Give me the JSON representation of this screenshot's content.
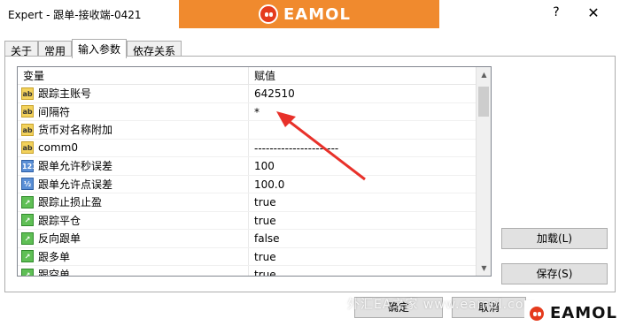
{
  "window": {
    "title": "Expert - 跟单-接收端-0421",
    "help_label": "?",
    "close_label": "✕"
  },
  "brand": {
    "name": "EAMOL",
    "color": "#f08a2e",
    "mark_color": "#e53b1d"
  },
  "tabs": [
    {
      "label": "关于"
    },
    {
      "label": "常用"
    },
    {
      "label": "输入参数"
    },
    {
      "label": "依存关系"
    }
  ],
  "grid": {
    "header_name": "变量",
    "header_value": "赋值",
    "rows": [
      {
        "icon": "ab",
        "name": "跟踪主账号",
        "value": "642510"
      },
      {
        "icon": "ab",
        "name": "间隔符",
        "value": "*"
      },
      {
        "icon": "ab",
        "name": "货币对名称附加",
        "value": ""
      },
      {
        "icon": "ab",
        "name": "comm0",
        "value": "----------------------"
      },
      {
        "icon": "123",
        "name": "跟单允许秒误差",
        "value": "100"
      },
      {
        "icon": "1/2",
        "name": "跟单允许点误差",
        "value": "100.0"
      },
      {
        "icon": "bool",
        "name": "跟踪止损止盈",
        "value": "true"
      },
      {
        "icon": "bool",
        "name": "跟踪平仓",
        "value": "true"
      },
      {
        "icon": "bool",
        "name": "反向跟单",
        "value": "false"
      },
      {
        "icon": "bool",
        "name": "跟多单",
        "value": "true"
      },
      {
        "icon": "bool",
        "name": "跟空单",
        "value": "true"
      }
    ]
  },
  "buttons": {
    "load": "加载(L)",
    "save": "保存(S)",
    "ok": "确定",
    "cancel": "取消"
  },
  "watermark": "外汇EA之家 www.eamol.com",
  "annotation_color": "#e8312a"
}
